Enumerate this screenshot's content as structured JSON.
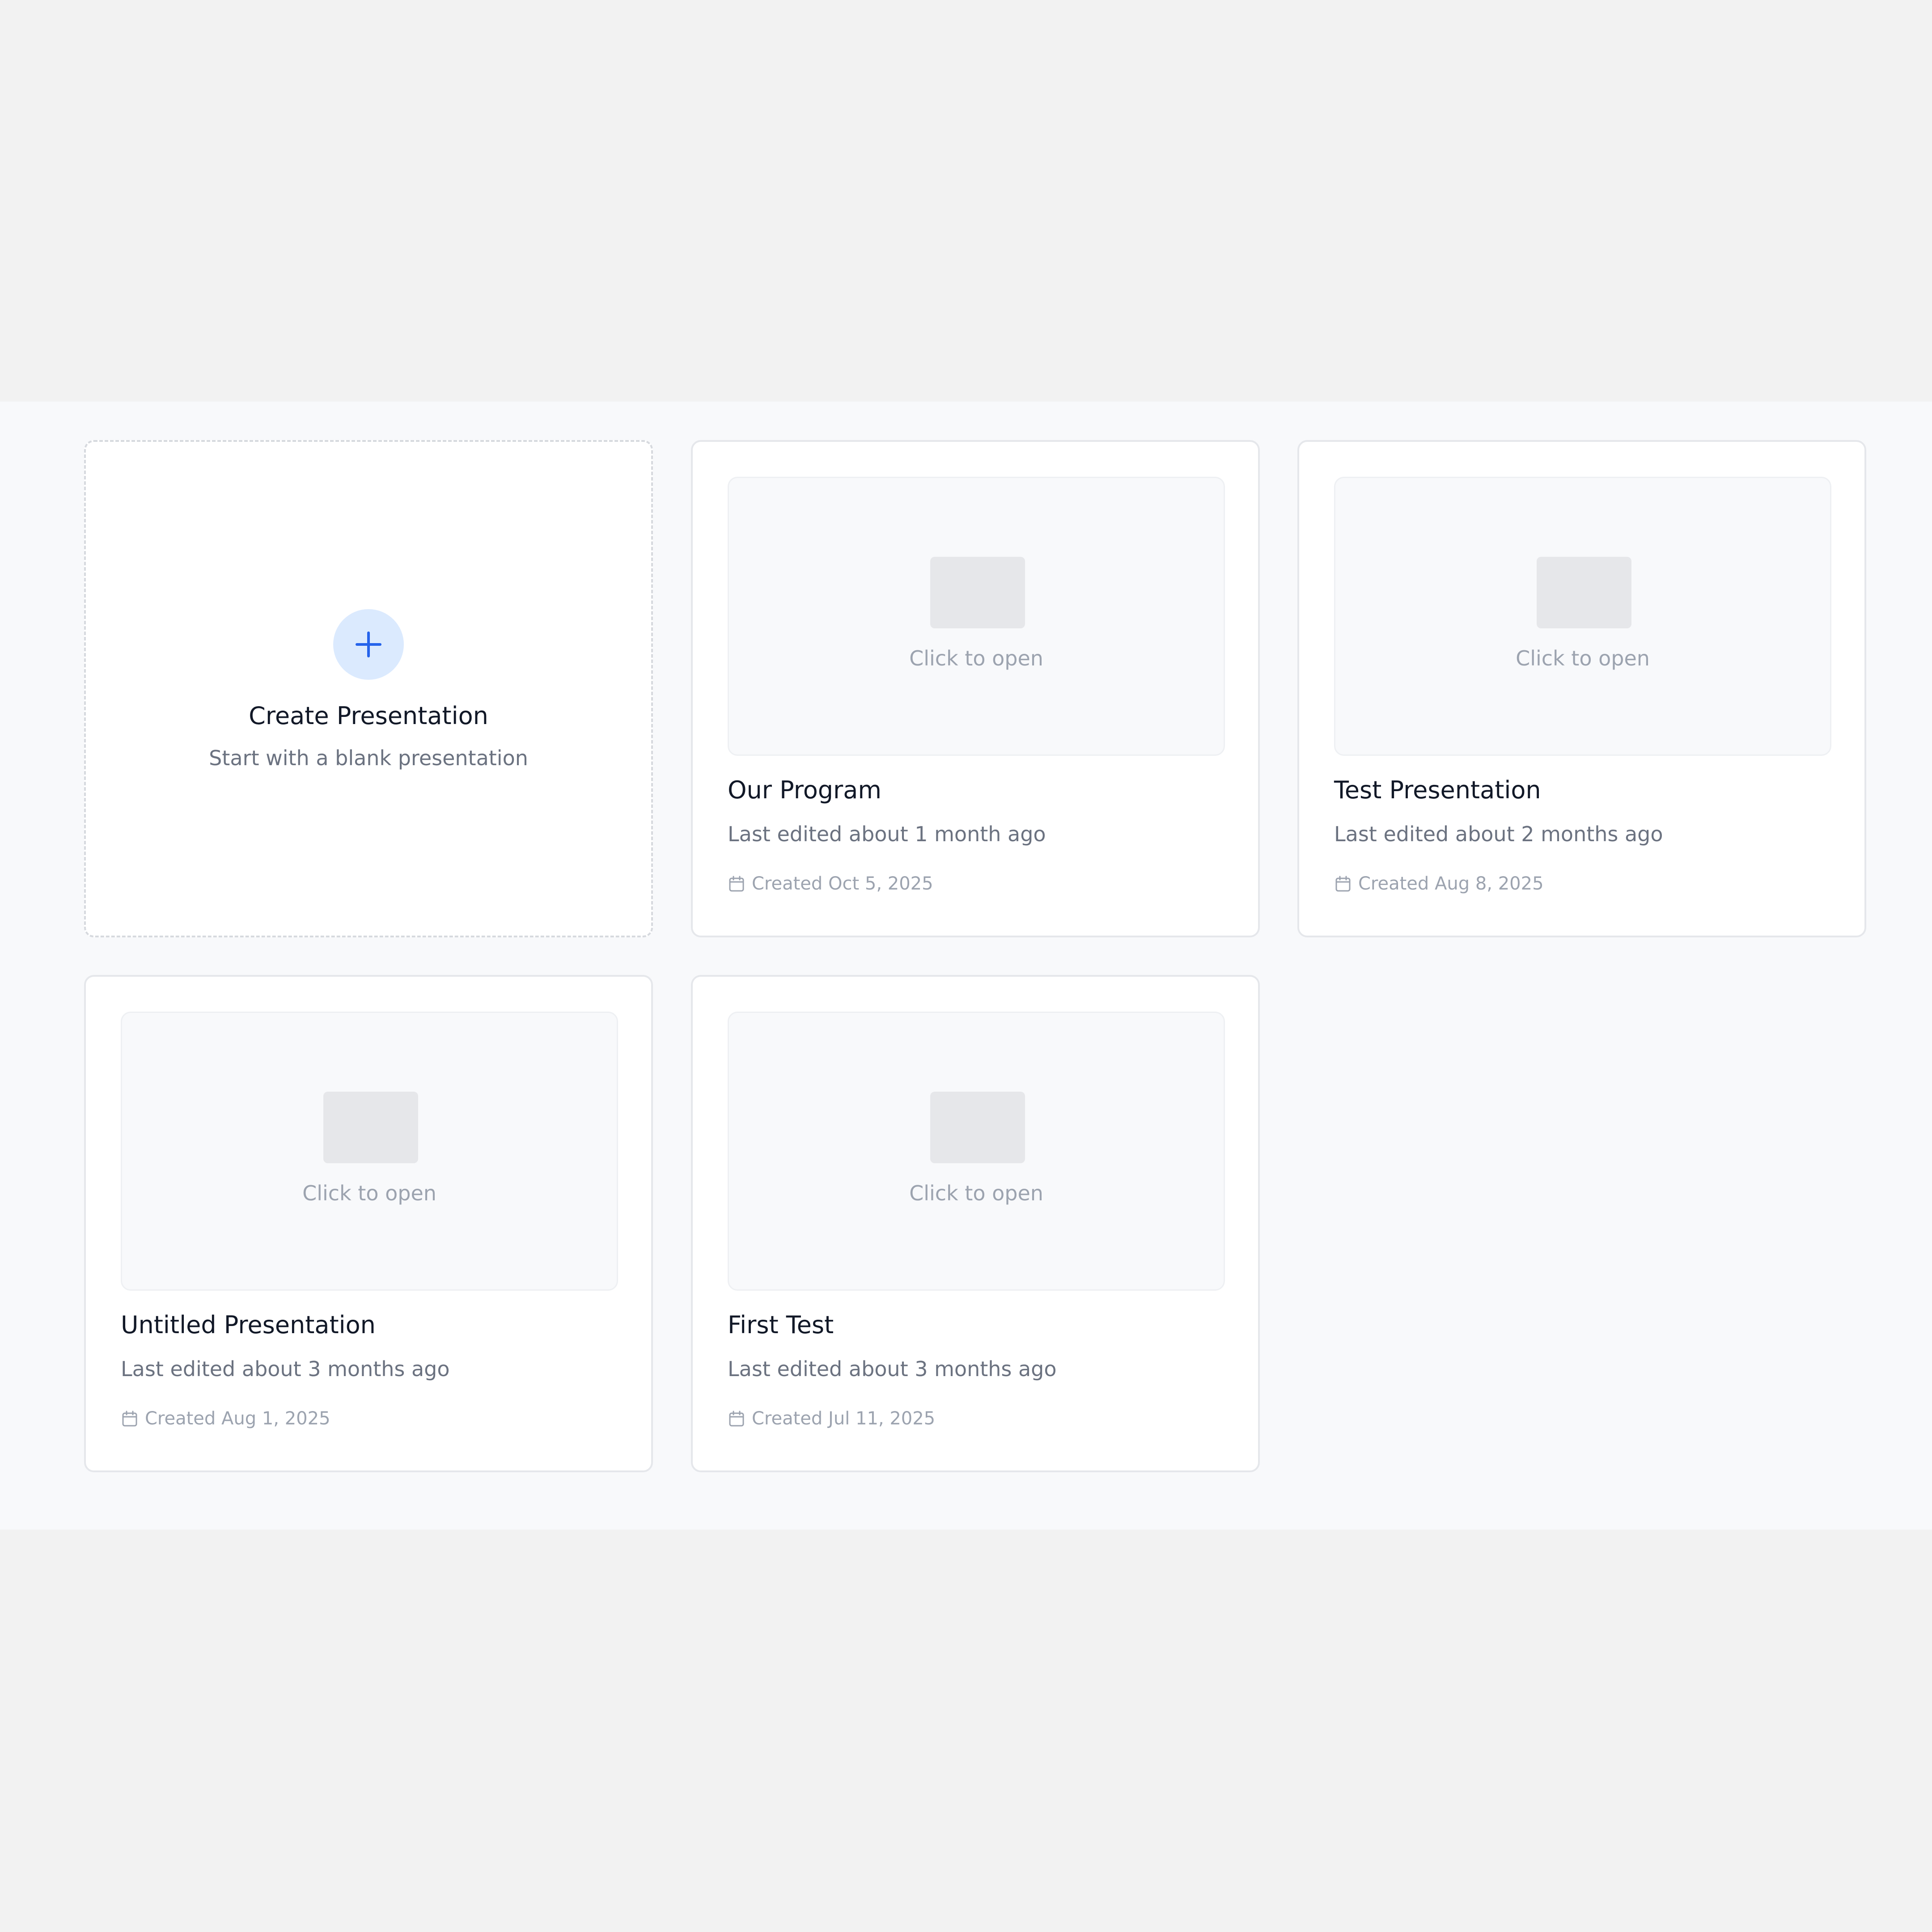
{
  "create_card": {
    "title": "Create Presentation",
    "subtitle": "Start with a blank presentation",
    "icon": "plus-icon"
  },
  "thumbnail_placeholder": "Click to open",
  "presentations": [
    {
      "title": "Our Program",
      "edited": "Last edited about 1 month ago",
      "created": "Created Oct 5, 2025"
    },
    {
      "title": "Test Presentation",
      "edited": "Last edited about 2 months ago",
      "created": "Created Aug 8, 2025"
    },
    {
      "title": "Untitled Presentation",
      "edited": "Last edited about 3 months ago",
      "created": "Created Aug 1, 2025"
    },
    {
      "title": "First Test",
      "edited": "Last edited about 3 months ago",
      "created": "Created Jul 11, 2025"
    }
  ],
  "colors": {
    "accent": "#2563eb",
    "accent_soft": "#dbeafe",
    "page_background": "#f2f2f2",
    "panel_background": "#f8f9fb"
  }
}
